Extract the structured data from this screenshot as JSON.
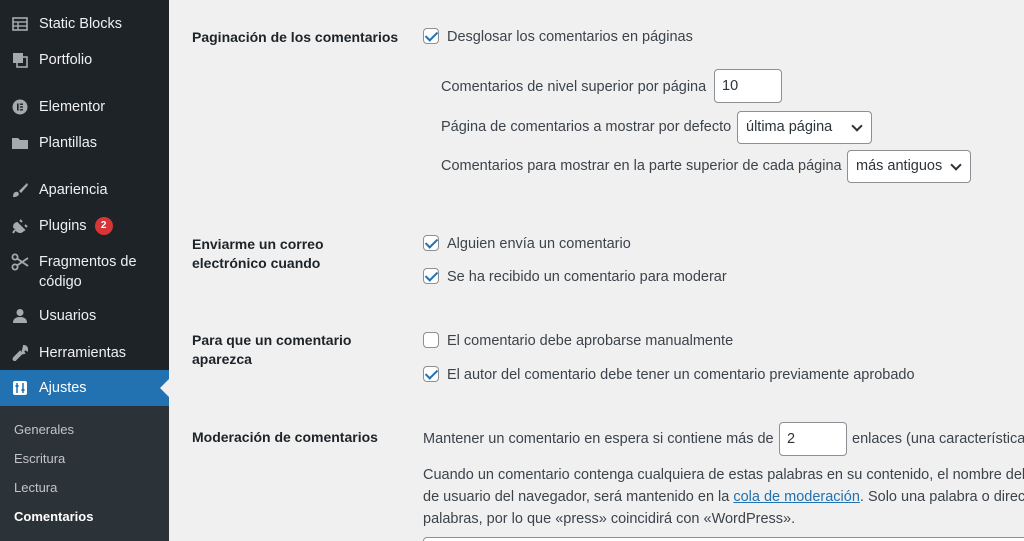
{
  "sidebar": {
    "items": [
      {
        "label": "Static Blocks",
        "icon": "table-icon"
      },
      {
        "label": "Portfolio",
        "icon": "portfolio-icon"
      },
      {
        "label": "Elementor",
        "icon": "elementor-icon"
      },
      {
        "label": "Plantillas",
        "icon": "folder-icon"
      },
      {
        "label": "Apariencia",
        "icon": "paintbrush-icon"
      },
      {
        "label": "Plugins",
        "icon": "plugin-icon",
        "badge": "2"
      },
      {
        "label": "Fragmentos de código",
        "icon": "scissors-icon"
      },
      {
        "label": "Usuarios",
        "icon": "user-icon"
      },
      {
        "label": "Herramientas",
        "icon": "wrench-icon"
      },
      {
        "label": "Ajustes",
        "icon": "settings-icon"
      }
    ],
    "submenu": [
      "Generales",
      "Escritura",
      "Lectura",
      "Comentarios"
    ],
    "accent_color": "#2271b1",
    "badge_color": "#d63638"
  },
  "settings": {
    "pagination": {
      "label": "Paginación de los comentarios",
      "break_label": "Desglosar los comentarios en páginas",
      "break_checked": true,
      "per_page_label": "Comentarios de nivel superior por página",
      "per_page_value": "10",
      "default_page_label": "Página de comentarios a mostrar por defecto",
      "default_page_value": "última página",
      "order_label": "Comentarios para mostrar en la parte superior de cada página",
      "order_value": "más antiguos"
    },
    "email": {
      "label": "Enviarme un correo electrónico cuando",
      "option1": "Alguien envía un comentario",
      "option1_checked": true,
      "option2": "Se ha recibido un comentario para moderar",
      "option2_checked": true
    },
    "appear": {
      "label": "Para que un comentario aparezca",
      "option1": "El comentario debe aprobarse manualmente",
      "option1_checked": false,
      "option2": "El autor del comentario debe tener un comentario previamente aprobado",
      "option2_checked": true
    },
    "moderation": {
      "label": "Moderación de comentarios",
      "hold_before": "Mantener un comentario en espera si contiene más de",
      "hold_value": "2",
      "hold_after": "enlaces (una característica",
      "desc_line1": "Cuando un comentario contenga cualquiera de estas palabras en su contenido, el nombre del",
      "desc_line2_before": "de usuario del navegador, será mantenido en la",
      "desc_line2_link": "cola de moderación",
      "desc_line2_after": ". Solo una palabra o direc",
      "desc_line3": "palabras, por lo que «press» coincidirá con «WordPress»."
    }
  }
}
